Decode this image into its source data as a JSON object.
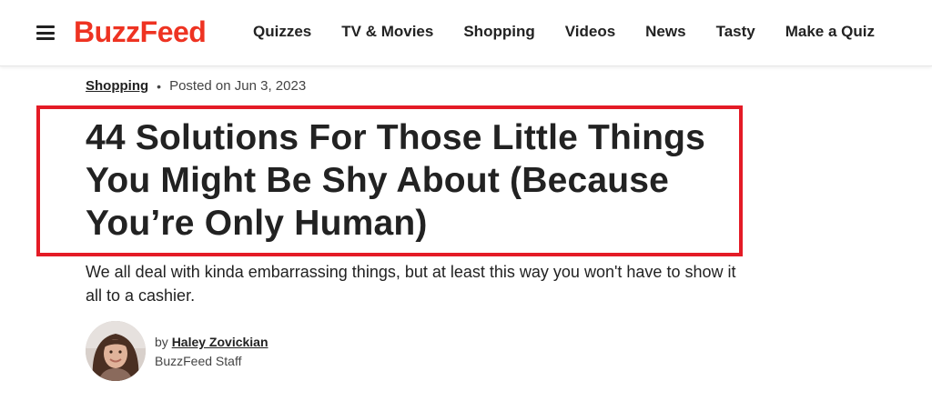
{
  "header": {
    "logo_text": "BuzzFeed",
    "nav": [
      {
        "label": "Quizzes"
      },
      {
        "label": "TV & Movies"
      },
      {
        "label": "Shopping"
      },
      {
        "label": "Videos"
      },
      {
        "label": "News"
      },
      {
        "label": "Tasty"
      },
      {
        "label": "Make a Quiz"
      }
    ]
  },
  "article": {
    "category": "Shopping",
    "separator": "•",
    "posted": "Posted on Jun 3, 2023",
    "headline": "44 Solutions For Those Little Things You Might Be Shy About (Because You’re Only Human)",
    "dek": "We all deal with kinda embarrassing things, but at least this way you won't have to show it all to a cashier.",
    "byline_prefix": "by",
    "author_name": "Haley Zovickian",
    "author_role": "BuzzFeed Staff"
  },
  "colors": {
    "brand": "#ee3322",
    "highlight_border": "#e41b26",
    "text": "#222222"
  },
  "icons": {
    "menu": "hamburger-menu-icon"
  }
}
